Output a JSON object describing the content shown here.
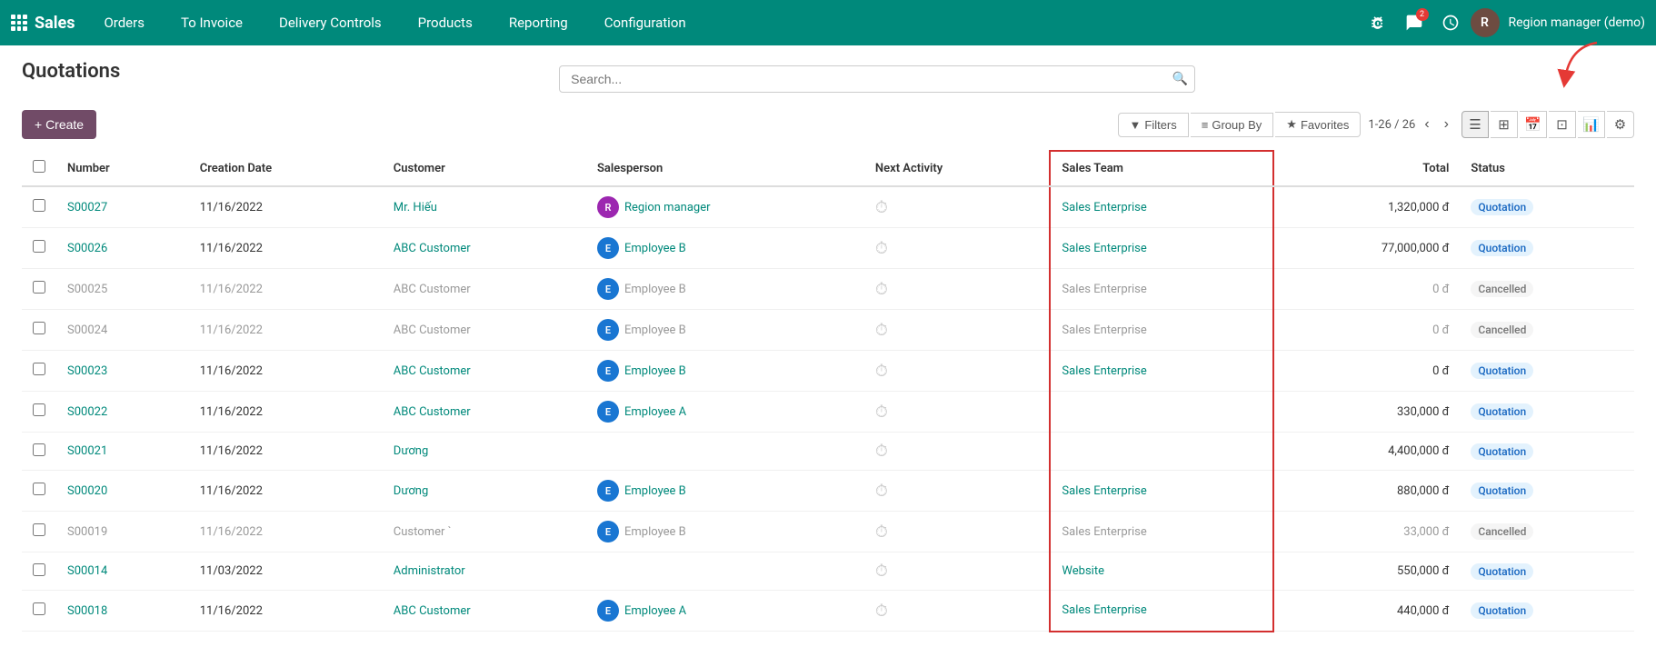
{
  "app": {
    "name": "Sales",
    "nav_items": [
      "Orders",
      "To Invoice",
      "Delivery Controls",
      "Products",
      "Reporting",
      "Configuration"
    ]
  },
  "header": {
    "search_placeholder": "Search...",
    "user_initial": "R",
    "user_name": "Region manager (demo)",
    "chat_badge": "2"
  },
  "page": {
    "title": "Quotations",
    "create_label": "+ Create"
  },
  "toolbar": {
    "filters_label": "Filters",
    "groupby_label": "Group By",
    "favorites_label": "Favorites",
    "pagination": "1-26 / 26"
  },
  "table": {
    "columns": [
      "Number",
      "Creation Date",
      "Customer",
      "Salesperson",
      "Next Activity",
      "Sales Team",
      "Total",
      "Status"
    ],
    "rows": [
      {
        "number": "S00027",
        "date": "11/16/2022",
        "customer": "Mr. Hiếu",
        "sp_initial": "R",
        "sp_class": "sp-avatar-r",
        "salesperson": "Region manager",
        "activity": "⏱",
        "sales_team": "Sales Enterprise",
        "total": "1,320,000 đ",
        "status": "Quotation",
        "status_class": "badge-quotation",
        "is_link": true,
        "is_muted": false
      },
      {
        "number": "S00026",
        "date": "11/16/2022",
        "customer": "ABC Customer",
        "sp_initial": "E",
        "sp_class": "sp-avatar-e",
        "salesperson": "Employee B",
        "activity": "⏱",
        "sales_team": "Sales Enterprise",
        "total": "77,000,000 đ",
        "status": "Quotation",
        "status_class": "badge-quotation",
        "is_link": true,
        "is_muted": false
      },
      {
        "number": "S00025",
        "date": "11/16/2022",
        "customer": "ABC Customer",
        "sp_initial": "E",
        "sp_class": "sp-avatar-e",
        "salesperson": "Employee B",
        "activity": "⏱",
        "sales_team": "Sales Enterprise",
        "total": "0 đ",
        "status": "Cancelled",
        "status_class": "badge-cancelled",
        "is_link": false,
        "is_muted": true
      },
      {
        "number": "S00024",
        "date": "11/16/2022",
        "customer": "ABC Customer",
        "sp_initial": "E",
        "sp_class": "sp-avatar-e",
        "salesperson": "Employee B",
        "activity": "⏱",
        "sales_team": "Sales Enterprise",
        "total": "0 đ",
        "status": "Cancelled",
        "status_class": "badge-cancelled",
        "is_link": false,
        "is_muted": true
      },
      {
        "number": "S00023",
        "date": "11/16/2022",
        "customer": "ABC Customer",
        "sp_initial": "E",
        "sp_class": "sp-avatar-e",
        "salesperson": "Employee B",
        "activity": "⏱",
        "sales_team": "Sales Enterprise",
        "total": "0 đ",
        "status": "Quotation",
        "status_class": "badge-quotation",
        "is_link": true,
        "is_muted": false
      },
      {
        "number": "S00022",
        "date": "11/16/2022",
        "customer": "ABC Customer",
        "sp_initial": "E",
        "sp_class": "sp-avatar-e",
        "salesperson": "Employee A",
        "activity": "⏱",
        "sales_team": "",
        "total": "330,000 đ",
        "status": "Quotation",
        "status_class": "badge-quotation",
        "is_link": true,
        "is_muted": false
      },
      {
        "number": "S00021",
        "date": "11/16/2022",
        "customer": "Dương",
        "sp_initial": "",
        "sp_class": "",
        "salesperson": "",
        "activity": "⏱",
        "sales_team": "",
        "total": "4,400,000 đ",
        "status": "Quotation",
        "status_class": "badge-quotation",
        "is_link": true,
        "is_muted": false
      },
      {
        "number": "S00020",
        "date": "11/16/2022",
        "customer": "Dương",
        "sp_initial": "E",
        "sp_class": "sp-avatar-e",
        "salesperson": "Employee B",
        "activity": "⏱",
        "sales_team": "Sales Enterprise",
        "total": "880,000 đ",
        "status": "Quotation",
        "status_class": "badge-quotation",
        "is_link": true,
        "is_muted": false
      },
      {
        "number": "S00019",
        "date": "11/16/2022",
        "customer": "Customer `",
        "sp_initial": "E",
        "sp_class": "sp-avatar-e",
        "salesperson": "Employee B",
        "activity": "⏱",
        "sales_team": "Sales Enterprise",
        "total": "33,000 đ",
        "status": "Cancelled",
        "status_class": "badge-cancelled",
        "is_link": false,
        "is_muted": true
      },
      {
        "number": "S00014",
        "date": "11/03/2022",
        "customer": "Administrator",
        "sp_initial": "",
        "sp_class": "",
        "salesperson": "",
        "activity": "⏱",
        "sales_team": "Website",
        "total": "550,000 đ",
        "status": "Quotation",
        "status_class": "badge-quotation",
        "is_link": true,
        "is_muted": false
      },
      {
        "number": "S00018",
        "date": "11/16/2022",
        "customer": "ABC Customer",
        "sp_initial": "E",
        "sp_class": "sp-avatar-e",
        "salesperson": "Employee A",
        "activity": "⏱",
        "sales_team": "Sales Enterprise",
        "total": "440,000 đ",
        "status": "Quotation",
        "status_class": "badge-quotation",
        "is_link": true,
        "is_muted": false,
        "is_last": true
      }
    ]
  }
}
